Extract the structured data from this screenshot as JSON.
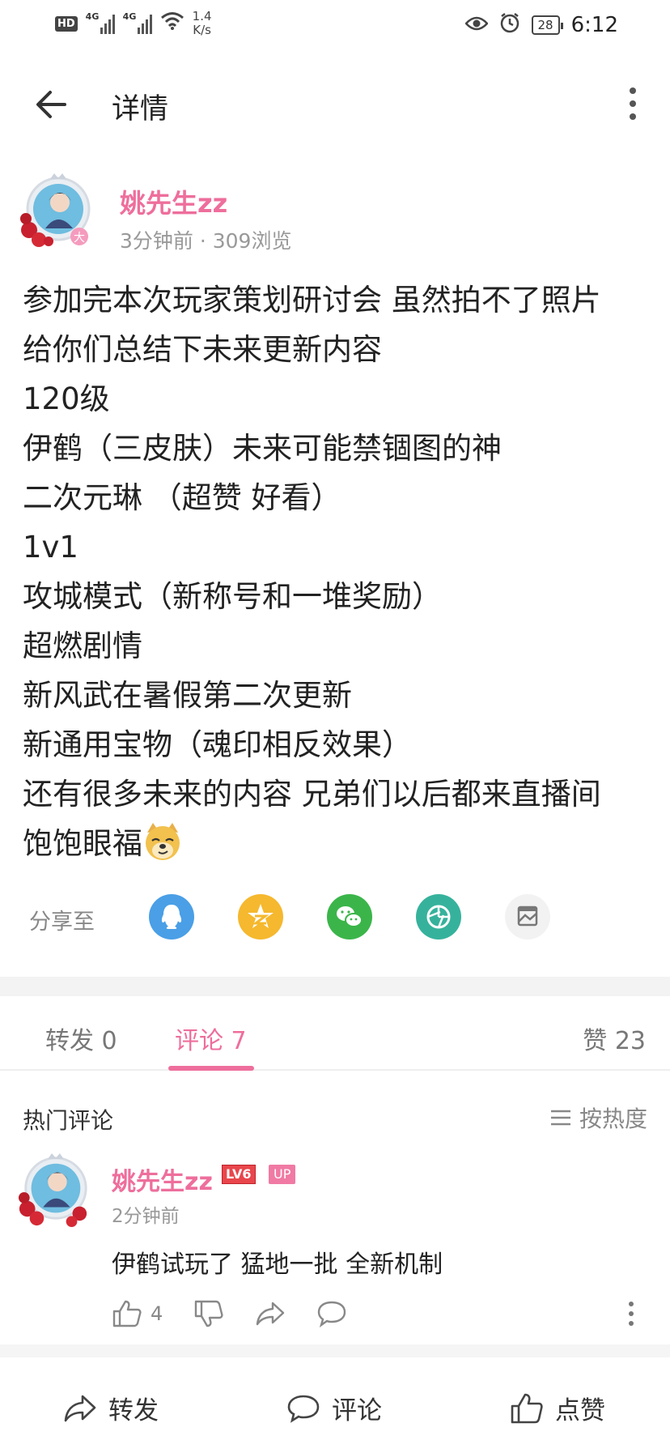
{
  "status_bar": {
    "hd": "HD",
    "signal1": "4G",
    "signal2": "4G",
    "speed_value": "1.4",
    "speed_unit": "K/s",
    "battery": "28",
    "time": "6:12"
  },
  "header": {
    "title": "详情"
  },
  "post": {
    "author": "姚先生zz",
    "badge": "大",
    "meta": "3分钟前 · 309浏览",
    "lines": [
      "参加完本次玩家策划研讨会 虽然拍不了照片",
      "给你们总结下未来更新内容",
      "120级",
      "伊鹤（三皮肤）未来可能禁锢图的神",
      "二次元琳 （超赞 好看）",
      "1v1",
      "攻城模式（新称号和一堆奖励）",
      "超燃剧情",
      "新风武在暑假第二次更新",
      "新通用宝物（魂印相反效果）",
      "还有很多未来的内容 兄弟们以后都来直播间",
      "饱饱眼福"
    ]
  },
  "share": {
    "label": "分享至",
    "targets": [
      "qq-icon",
      "qzone-icon",
      "wechat-icon",
      "moments-icon",
      "save-image-icon"
    ]
  },
  "tabs": {
    "repost": "转发 0",
    "comment": "评论 7",
    "like": "赞 23"
  },
  "hot_comments": {
    "title": "热门评论",
    "sort_label": "按热度",
    "items": [
      {
        "author": "姚先生zz",
        "level": "LV6",
        "up_badge": "UP",
        "time": "2分钟前",
        "text": "伊鹤试玩了 猛地一批 全新机制",
        "likes": "4"
      }
    ]
  },
  "bottom_bar": {
    "repost": "转发",
    "comment": "评论",
    "like": "点赞"
  },
  "colors": {
    "accent_pink": "#ee6e9c",
    "qq_blue": "#4a9fe6",
    "qzone_yellow": "#f5b82e",
    "wechat_green": "#3bb54a",
    "moments_teal": "#36b29c"
  }
}
